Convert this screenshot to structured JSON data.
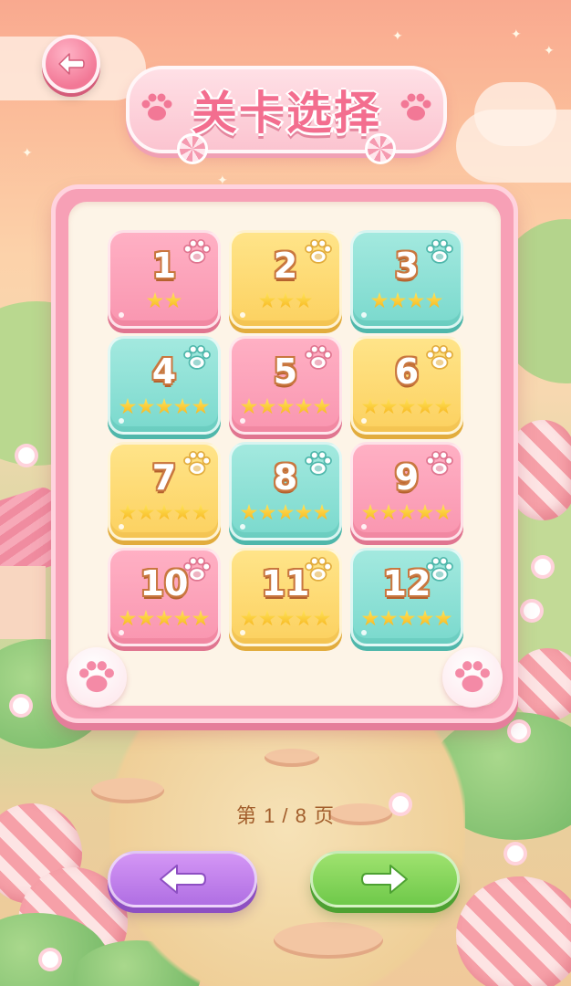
{
  "header": {
    "title": "关卡选择"
  },
  "levels": [
    {
      "number": "1",
      "color": "pink",
      "stars": 2
    },
    {
      "number": "2",
      "color": "yellow",
      "stars": 3
    },
    {
      "number": "3",
      "color": "teal",
      "stars": 4
    },
    {
      "number": "4",
      "color": "teal",
      "stars": 5
    },
    {
      "number": "5",
      "color": "pink",
      "stars": 5
    },
    {
      "number": "6",
      "color": "yellow",
      "stars": 5
    },
    {
      "number": "7",
      "color": "yellow",
      "stars": 5
    },
    {
      "number": "8",
      "color": "teal",
      "stars": 5
    },
    {
      "number": "9",
      "color": "pink",
      "stars": 5
    },
    {
      "number": "10",
      "color": "pink",
      "stars": 5
    },
    {
      "number": "11",
      "color": "yellow",
      "stars": 5
    },
    {
      "number": "12",
      "color": "teal",
      "stars": 5
    }
  ],
  "pagination": {
    "label": "第 1 / 8 页",
    "current": 1,
    "total": 8
  },
  "icons": {
    "back": "arrow-left-icon",
    "prev": "arrow-left-icon",
    "next": "arrow-right-icon",
    "paw": "paw-icon",
    "star": "star-icon"
  },
  "colors": {
    "pink": "#f996b0",
    "yellow": "#fcd160",
    "teal": "#7ad9cd",
    "prev_button": "#b06fe3",
    "next_button": "#6fc94a",
    "title": "#f36e8f"
  }
}
